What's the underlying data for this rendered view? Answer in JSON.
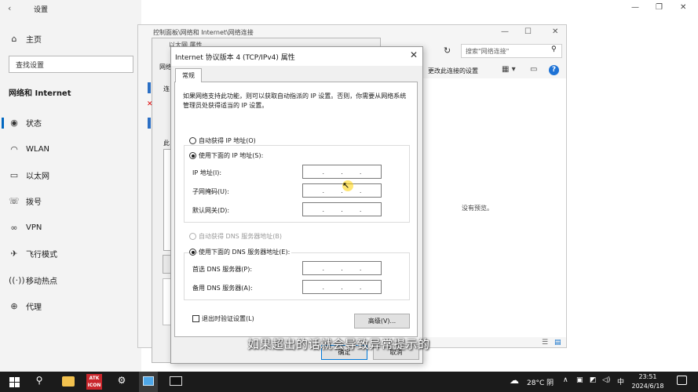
{
  "settings": {
    "title": "设置",
    "home": "主页",
    "search_placeholder": "查找设置",
    "section": "网络和 Internet",
    "nav": [
      {
        "icon": "home-icon",
        "label": "主页"
      },
      {
        "icon": "status-icon",
        "label": "状态"
      },
      {
        "icon": "wifi-icon",
        "label": "WLAN"
      },
      {
        "icon": "ethernet-icon",
        "label": "以太网"
      },
      {
        "icon": "dialup-icon",
        "label": "拨号"
      },
      {
        "icon": "vpn-icon",
        "label": "VPN"
      },
      {
        "icon": "airplane-icon",
        "label": "飞行模式"
      },
      {
        "icon": "hotspot-icon",
        "label": "移动热点"
      },
      {
        "icon": "proxy-icon",
        "label": "代理"
      }
    ]
  },
  "network_window": {
    "title": "控制面板\\网络和 Internet\\网络连接",
    "search_placeholder": "搜索\"网络连接\"",
    "change_settings": "更改此连接的设置",
    "no_preview": "没有预览。"
  },
  "ethernet_window": {
    "title": "以太网 属性",
    "tab_fragment": "网络",
    "frag1": "连",
    "frag2": "此"
  },
  "ipv4_dialog": {
    "title": "Internet 协议版本 4 (TCP/IPv4) 属性",
    "tab": "常规",
    "description": "如果网络支持此功能，则可以获取自动指派的 IP 设置。否则，你需要从网络系统管理员处获得适当的 IP 设置。",
    "auto_ip": "自动获得 IP 地址(O)",
    "manual_ip": "使用下面的 IP 地址(S):",
    "ip_label": "IP 地址(I):",
    "subnet_label": "子网掩码(U):",
    "gateway_label": "默认网关(D):",
    "auto_dns": "自动获得 DNS 服务器地址(B)",
    "manual_dns": "使用下面的 DNS 服务器地址(E):",
    "pref_dns_label": "首选 DNS 服务器(P):",
    "alt_dns_label": "备用 DNS 服务器(A):",
    "validate_label": "退出时验证设置(L)",
    "advanced_button": "高级(V)...",
    "ok_button": "确定",
    "cancel_button": "取消",
    "dot": "."
  },
  "subtitle": "如果超出的话就会导致异常提示的",
  "taskbar": {
    "app_label_1": "ATK",
    "app_label_2": "ICON",
    "weather": "28°C 阴",
    "ime": "中",
    "time": "23:51",
    "date": "2024/6/18"
  },
  "colors": {
    "accent": "#0078d7",
    "taskbar": "#1b1b1b",
    "settings_sidebar": "#f3f3f3"
  }
}
